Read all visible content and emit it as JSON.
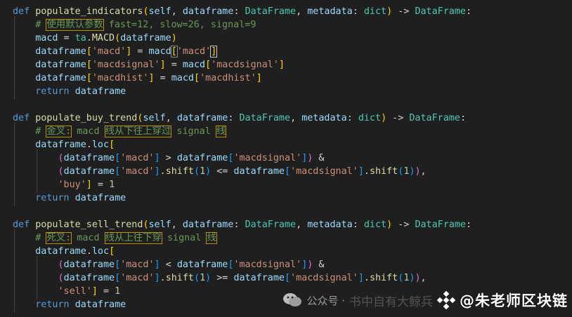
{
  "code": {
    "block1": {
      "def_kw": "def",
      "name": "populate_indicators",
      "self": "self",
      "p1": "dataframe",
      "p1_type": "DataFrame",
      "p2": "metadata",
      "p2_type": "dict",
      "ret_type": "DataFrame",
      "comment_hash": "# ",
      "comment_cjk": "使用默认参数",
      "comment_rest": " fast=12, slow=26, signal=9",
      "l3_var": "macd",
      "l3_mod": "ta",
      "l3_fn": "MACD",
      "l3_arg": "dataframe",
      "key_macd": "'macd'",
      "key_macdsignal": "'macdsignal'",
      "key_macdhist": "'macdhist'",
      "kw_return": "return",
      "ret_val": "dataframe"
    },
    "block2": {
      "name": "populate_buy_trend",
      "comment_cjk1": "金叉:",
      "comment_mid1": " macd ",
      "comment_cjk2": "线从下往上穿过",
      "comment_mid2": " signal ",
      "comment_cjk3": "线",
      "loc": "loc",
      "op1": ">",
      "op2": "<=",
      "fn_shift": "shift",
      "num1": "1",
      "key_buy": "'buy'"
    },
    "block3": {
      "name": "populate_sell_trend",
      "comment_cjk1": "死叉:",
      "comment_mid1": " macd ",
      "comment_cjk2": "线从上往下穿",
      "comment_mid2": " signal ",
      "comment_cjk3": "线",
      "op1": "<",
      "op2": ">=",
      "key_sell": "'sell'"
    }
  },
  "watermark": {
    "platform_icon": "wechat-icon",
    "label": "公众号 ·",
    "ghost_text": "书中自有大鲸兵",
    "logo_icon": "binance-logo-icon",
    "author": "@朱老师区块链"
  }
}
